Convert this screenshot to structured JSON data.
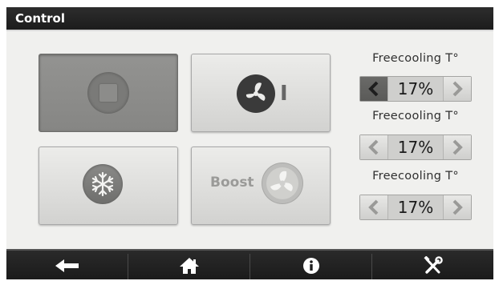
{
  "window": {
    "title": "Control"
  },
  "tiles": {
    "stop": {
      "icon": "stop-icon",
      "state": "pressed"
    },
    "fan_speed": {
      "icon": "fan-icon",
      "speed_label": "I"
    },
    "cooling": {
      "icon": "snowflake-icon"
    },
    "boost": {
      "icon": "fan-icon",
      "label": "Boost"
    }
  },
  "settings": [
    {
      "label": "Freecooling T°",
      "value": "17%"
    },
    {
      "label": "Freecooling T°",
      "value": "17%"
    },
    {
      "label": "Freecooling T°",
      "value": "17%"
    }
  ],
  "navbar": [
    {
      "icon": "back-arrow-icon"
    },
    {
      "icon": "home-icon"
    },
    {
      "icon": "info-icon"
    },
    {
      "icon": "tools-icon"
    }
  ],
  "colors": {
    "titlebar": "#1c1c1c",
    "panel": "#f0f0ee",
    "pressed_tile": "#8a8a88"
  }
}
